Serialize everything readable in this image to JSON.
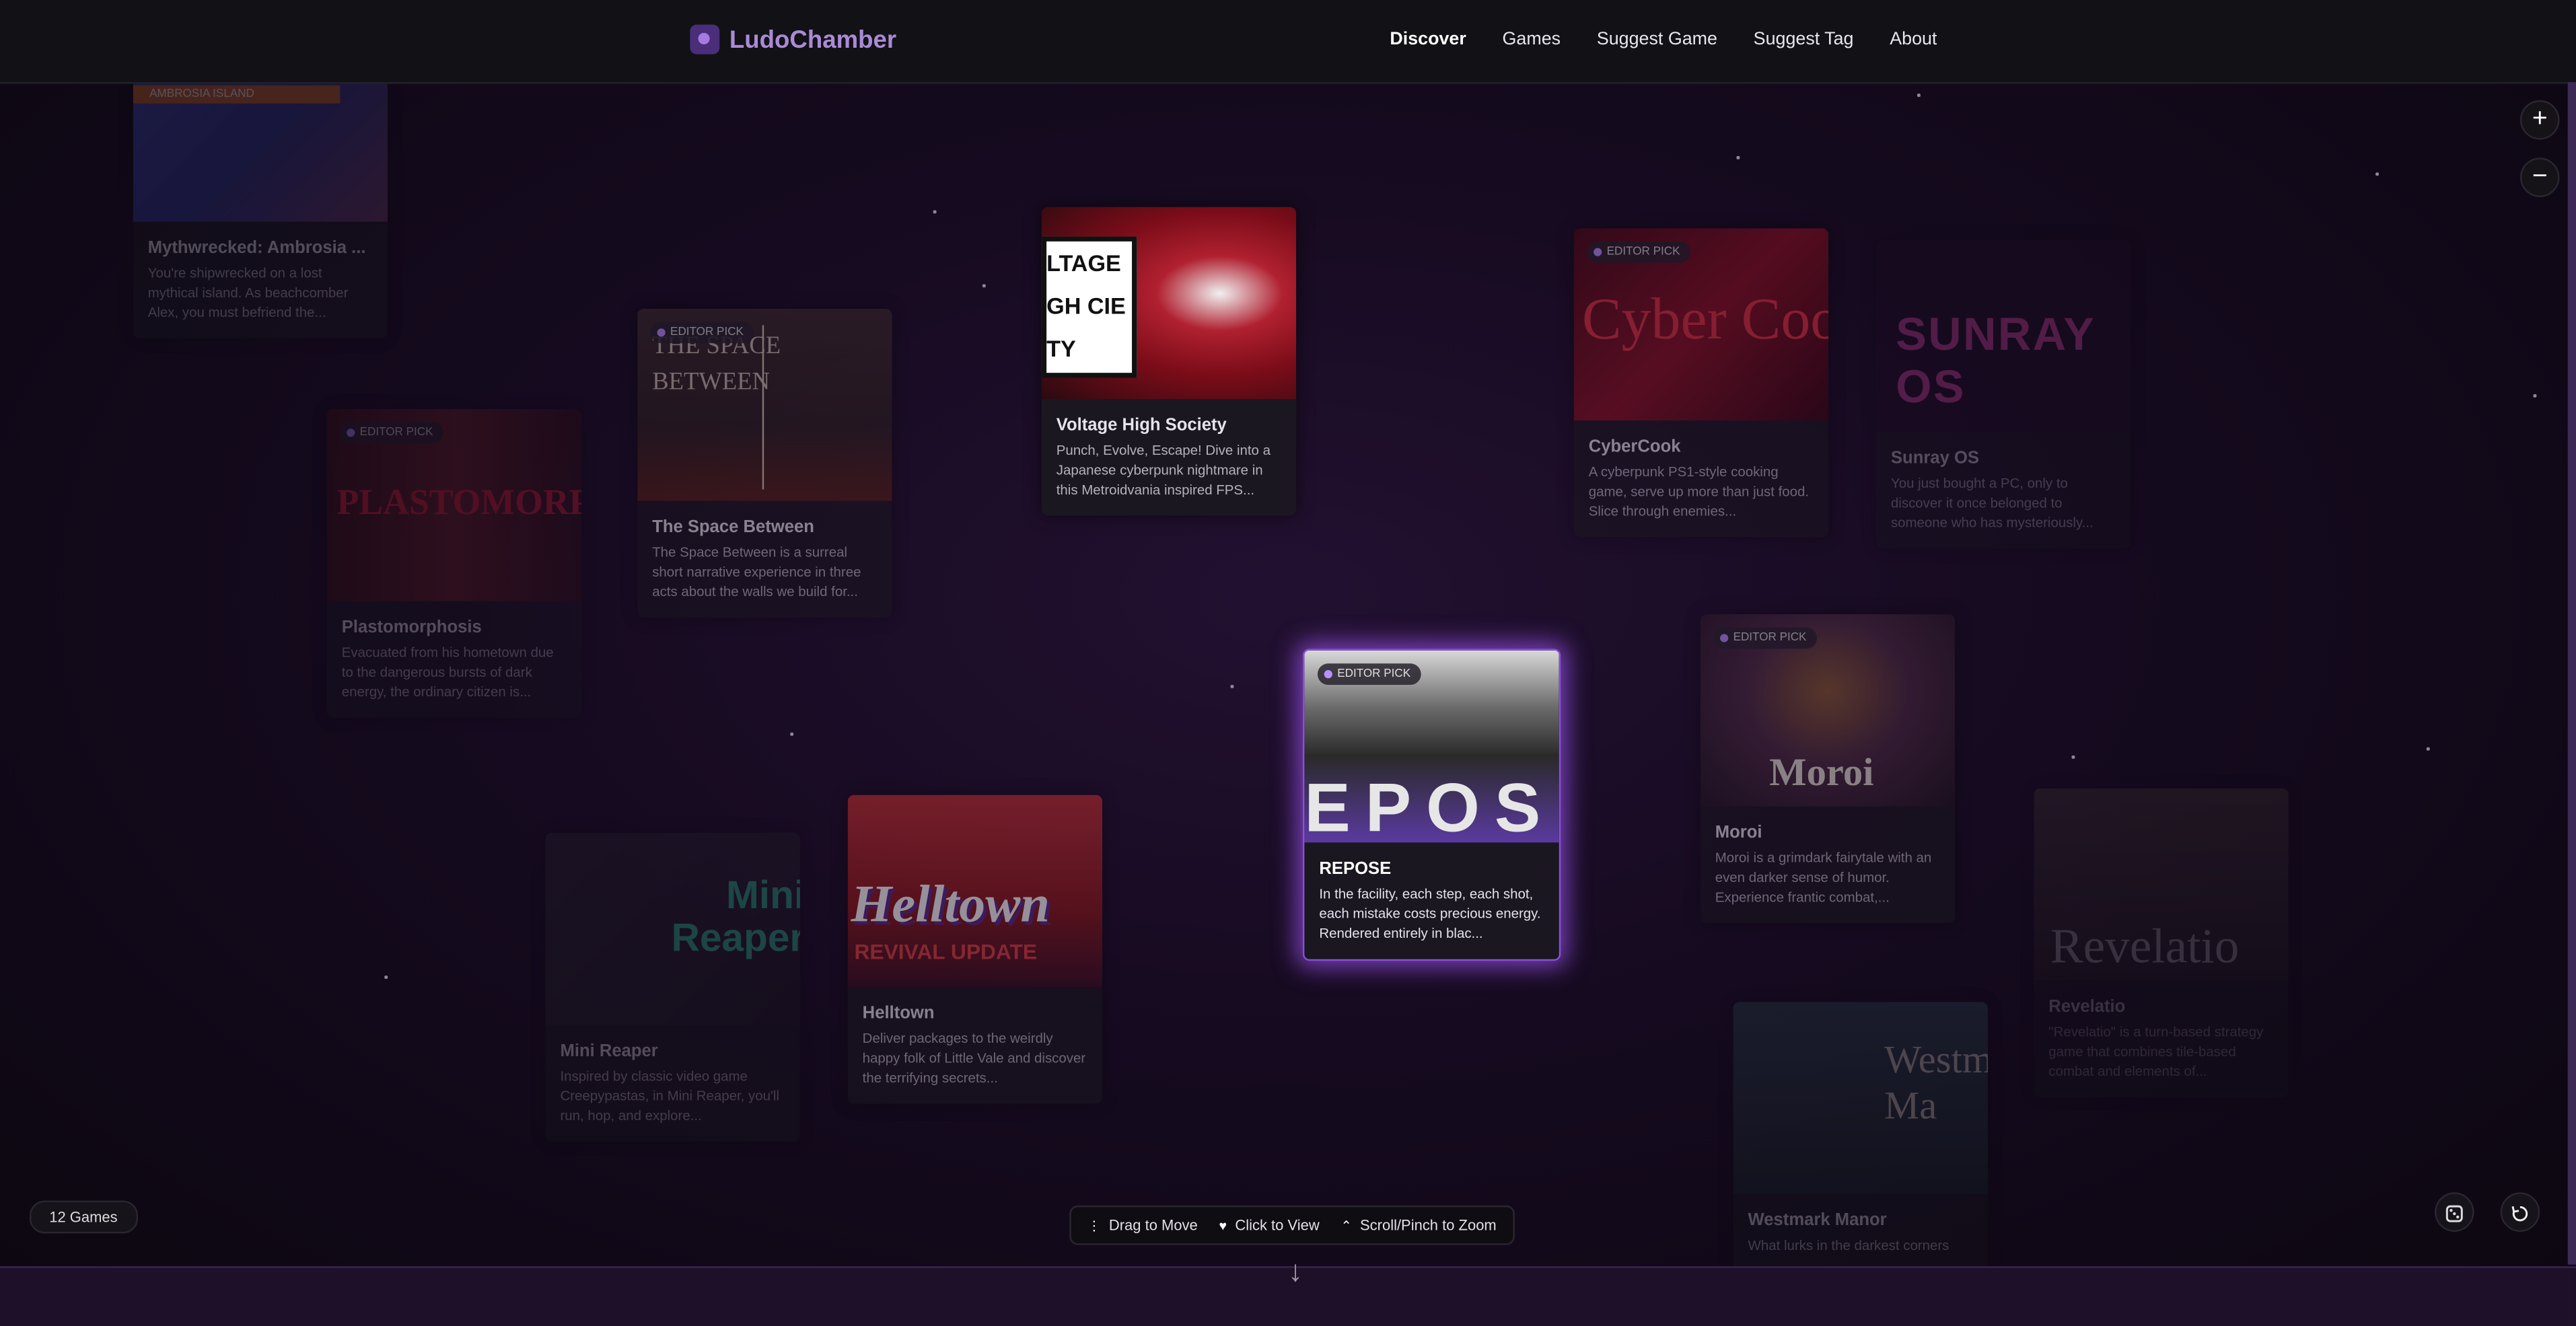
{
  "header": {
    "logo_text": "LudoChamber",
    "nav": [
      {
        "label": "Discover",
        "active": true
      },
      {
        "label": "Games"
      },
      {
        "label": "Suggest Game"
      },
      {
        "label": "Suggest Tag"
      },
      {
        "label": "About"
      }
    ]
  },
  "zoom": {
    "in_icon": "plus-icon",
    "out_icon": "minus-icon",
    "in_label": "+",
    "out_label": "−"
  },
  "editor_pick_label": "EDITOR PICK",
  "cards": [
    {
      "key": "mythwrecked",
      "title": "Mythwrecked: Ambrosia ...",
      "desc": "You're shipwrecked on a lost mythical island. As beachcomber Alex, you must befriend the...",
      "thumb_text": "AMBROSIA ISLAND",
      "editor_pick": false
    },
    {
      "key": "spacebetween",
      "title": "The Space Between",
      "desc": "The Space Between is a surreal short narrative experience in three acts about the walls we build for...",
      "thumb_text": "THE SPACE BETWEEN",
      "editor_pick": true
    },
    {
      "key": "voltage",
      "title": "Voltage High Society",
      "desc": "Punch, Evolve, Escape! Dive into a Japanese cyberpunk nightmare in this Metroidvania inspired FPS...",
      "thumb_text": "LTAGE GH CIETY",
      "editor_pick": false
    },
    {
      "key": "cybercook",
      "title": "CyberCook",
      "desc": "A cyberpunk PS1-style cooking game, serve up more than just food. Slice through enemies...",
      "thumb_text": "Cyber Coo",
      "editor_pick": true
    },
    {
      "key": "sunray",
      "title": "Sunray OS",
      "desc": "You just bought a PC, only to discover it once belonged to someone who has mysteriously...",
      "thumb_text": "SUNRAY OS",
      "editor_pick": false
    },
    {
      "key": "plasto",
      "title": "Plastomorphosis",
      "desc": "Evacuated from his hometown due to the dangerous bursts of dark energy, the ordinary citizen is...",
      "thumb_text": "PLASTOMORPH",
      "editor_pick": true
    },
    {
      "key": "repose",
      "title": "REPOSE",
      "desc": "In the facility, each step, each shot, each mistake costs precious energy. Rendered entirely in blac...",
      "thumb_text": "EPOS",
      "editor_pick": true
    },
    {
      "key": "moroi",
      "title": "Moroi",
      "desc": "Moroi is a grimdark fairytale with an even darker sense of humor. Experience frantic combat,...",
      "thumb_text": "Moroi",
      "editor_pick": true
    },
    {
      "key": "helltown",
      "title": "Helltown",
      "desc": "Deliver packages to the weirdly happy folk of Little Vale and discover the terrifying secrets...",
      "thumb_text": "Helltown",
      "thumb_sub": "REVIVAL UPDATE",
      "editor_pick": false
    },
    {
      "key": "minireaper",
      "title": "Mini Reaper",
      "desc": "Inspired by classic video game Creepypastas, in Mini Reaper, you'll run, hop, and explore...",
      "thumb_text": "Mini Reaper",
      "editor_pick": false
    },
    {
      "key": "revelatio",
      "title": "Revelatio",
      "desc": "\"Revelatio\" is a turn-based strategy game that combines tile-based combat and elements of...",
      "thumb_text": "Revelatio",
      "editor_pick": false
    },
    {
      "key": "westmark",
      "title": "Westmark Manor",
      "desc": "What lurks in the darkest corners",
      "thumb_text": "Westm Ma",
      "editor_pick": false
    }
  ],
  "footer": {
    "games_count": "12 Games",
    "hints": [
      {
        "icon": "drag-icon",
        "glyph": "⋮",
        "label": "Drag to Move"
      },
      {
        "icon": "heart-icon",
        "glyph": "♥",
        "label": "Click to View"
      },
      {
        "icon": "chevron-up-icon",
        "glyph": "⌃",
        "label": "Scroll/Pinch to Zoom"
      }
    ],
    "dice_icon": "dice-icon",
    "reset_icon": "reset-icon",
    "down_icon": "arrow-down-icon"
  }
}
